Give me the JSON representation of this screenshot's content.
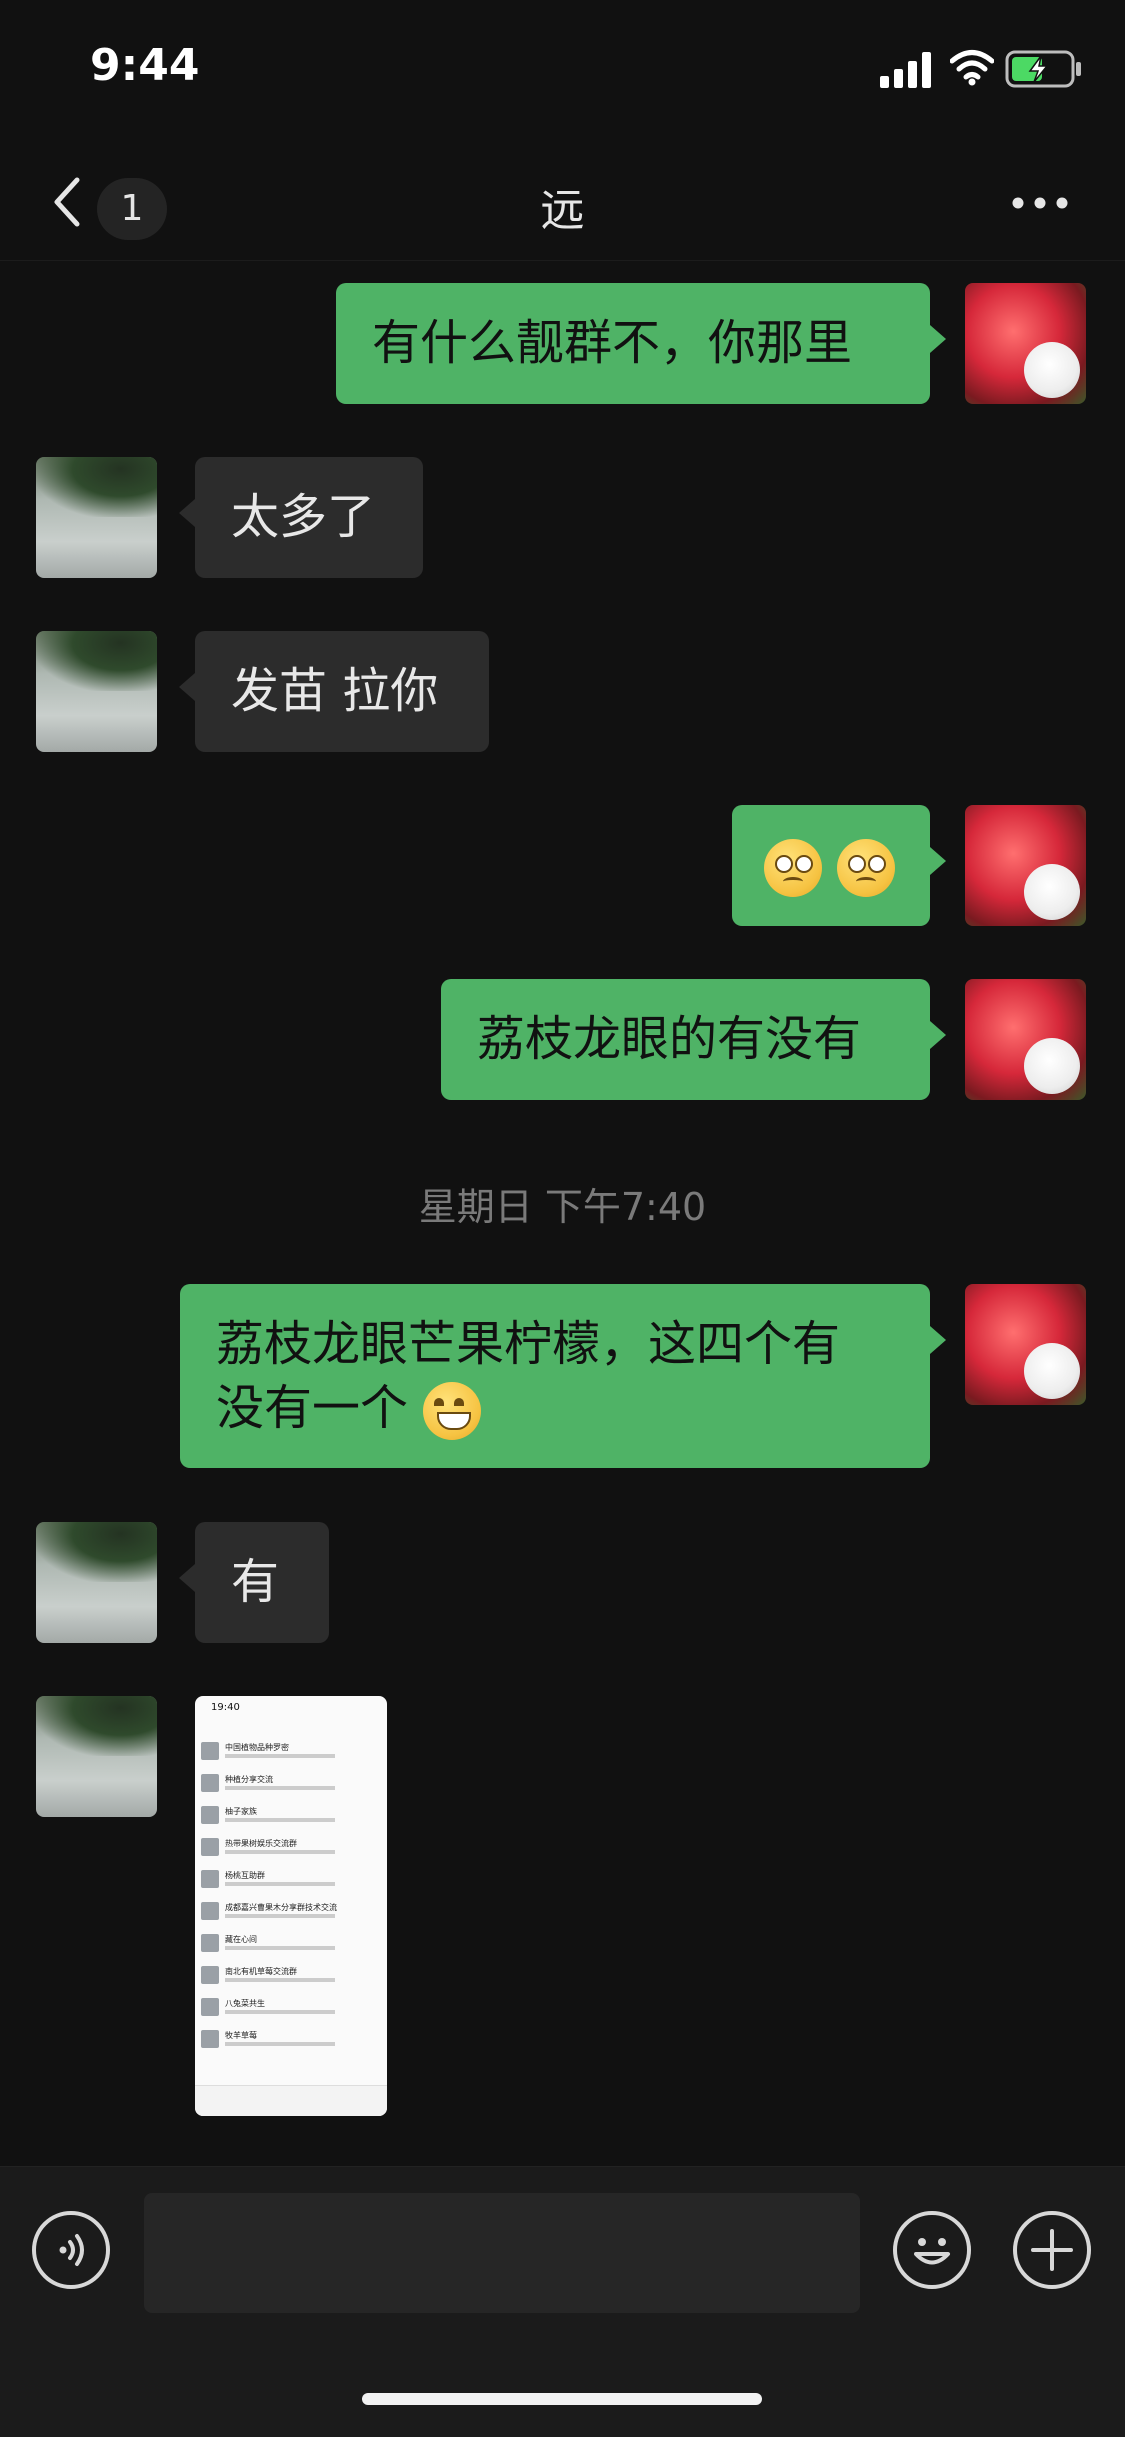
{
  "status_bar": {
    "time": "9:44"
  },
  "nav": {
    "back_count": "1",
    "title": "远"
  },
  "messages": [
    {
      "from": "me",
      "text": "有什么靓群不，你那里"
    },
    {
      "from": "other",
      "text": "太多了"
    },
    {
      "from": "other",
      "text": "发苗 拉你"
    },
    {
      "from": "me",
      "emoji": [
        "pleading-face",
        "pleading-face"
      ]
    },
    {
      "from": "me",
      "text": "荔枝龙眼的有没有"
    },
    {
      "from": "me",
      "text_line1": "荔枝龙眼芒果柠檬，这四个有",
      "text_line2": "没有一个",
      "emoji": "grinning-face"
    },
    {
      "from": "other",
      "text": "有"
    },
    {
      "from": "other",
      "type": "image",
      "thumb_time": "19:40"
    }
  ],
  "timestamp": "星期日 下午7:40",
  "screenshot_thumb_rows": [
    "中国植物品种罗密",
    "种植分享交流",
    "柚子家族",
    "热带果树娱乐交流群",
    "杨桃互助群",
    "成都嘉兴曹果木分享群技术交流",
    "藏在心间",
    "南北有机草莓交流群",
    "八兔菜共生",
    "牧羊草莓"
  ],
  "icons": {
    "back": "chevron-left-icon",
    "more": "ellipsis-icon",
    "voice": "voice-icon",
    "emoji": "smiley-icon",
    "plus": "plus-icon"
  },
  "colors": {
    "bubble_me": "#4fb366",
    "bubble_other": "#2c2c2c",
    "background": "#111111"
  }
}
